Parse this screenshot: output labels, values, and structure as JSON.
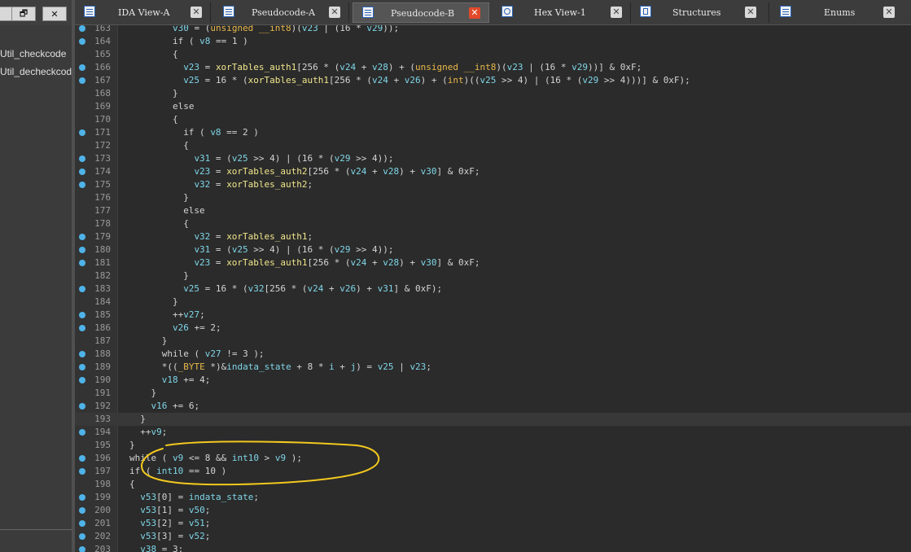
{
  "left_panel": {
    "buttons": [
      "",
      "🗗",
      "✕"
    ],
    "functions": [
      "Util_checkcode",
      "Util_decheckcode"
    ]
  },
  "tabs": [
    {
      "label": "IDA View-A",
      "icon": "listing-icon",
      "active": false
    },
    {
      "label": "Pseudocode-A",
      "icon": "pseudocode-icon",
      "active": false
    },
    {
      "label": "Pseudocode-B",
      "icon": "pseudocode-icon",
      "active": true
    },
    {
      "label": "Hex View-1",
      "icon": "hex-icon",
      "active": false
    },
    {
      "label": "Structures",
      "icon": "structures-icon",
      "active": false
    },
    {
      "label": "Enums",
      "icon": "enums-icon",
      "active": false
    }
  ],
  "tab_close_glyph": "✕",
  "highlighted_line": 193,
  "colors": {
    "breakpoint_dot": "#4fb3e8",
    "annotation_ellipse": "#f2c81e",
    "active_close": "#e2492b"
  },
  "code_lines": [
    {
      "n": 163,
      "dot": true,
      "indent": 7,
      "tokens": [
        [
          "v",
          "v30"
        ],
        [
          "p",
          " = ("
        ],
        [
          "k",
          "unsigned __int8"
        ],
        [
          "p",
          ")("
        ],
        [
          "v",
          "v23"
        ],
        [
          "p",
          " | (16 * "
        ],
        [
          "v",
          "v29"
        ],
        [
          "p",
          "));"
        ]
      ]
    },
    {
      "n": 164,
      "dot": true,
      "indent": 7,
      "tokens": [
        [
          "p",
          "if ( "
        ],
        [
          "v",
          "v8"
        ],
        [
          "p",
          " == 1 )"
        ]
      ]
    },
    {
      "n": 165,
      "dot": false,
      "indent": 7,
      "tokens": [
        [
          "p",
          "{"
        ]
      ]
    },
    {
      "n": 166,
      "dot": true,
      "indent": 8,
      "tokens": [
        [
          "v",
          "v23"
        ],
        [
          "p",
          " = "
        ],
        [
          "f",
          "xorTables_auth1"
        ],
        [
          "p",
          "[256 * ("
        ],
        [
          "v",
          "v24"
        ],
        [
          "p",
          " + "
        ],
        [
          "v",
          "v28"
        ],
        [
          "p",
          ") + ("
        ],
        [
          "k",
          "unsigned __int8"
        ],
        [
          "p",
          ")("
        ],
        [
          "v",
          "v23"
        ],
        [
          "p",
          " | (16 * "
        ],
        [
          "v",
          "v29"
        ],
        [
          "p",
          "))] & 0xF;"
        ]
      ]
    },
    {
      "n": 167,
      "dot": true,
      "indent": 8,
      "tokens": [
        [
          "v",
          "v25"
        ],
        [
          "p",
          " = 16 * ("
        ],
        [
          "f",
          "xorTables_auth1"
        ],
        [
          "p",
          "[256 * ("
        ],
        [
          "v",
          "v24"
        ],
        [
          "p",
          " + "
        ],
        [
          "v",
          "v26"
        ],
        [
          "p",
          ") + ("
        ],
        [
          "k",
          "int"
        ],
        [
          "p",
          ")(("
        ],
        [
          "v",
          "v25"
        ],
        [
          "p",
          " >> 4) | (16 * ("
        ],
        [
          "v",
          "v29"
        ],
        [
          "p",
          " >> 4)))] & 0xF);"
        ]
      ]
    },
    {
      "n": 168,
      "dot": false,
      "indent": 7,
      "tokens": [
        [
          "p",
          "}"
        ]
      ]
    },
    {
      "n": 169,
      "dot": false,
      "indent": 7,
      "tokens": [
        [
          "p",
          "else"
        ]
      ]
    },
    {
      "n": 170,
      "dot": false,
      "indent": 7,
      "tokens": [
        [
          "p",
          "{"
        ]
      ]
    },
    {
      "n": 171,
      "dot": true,
      "indent": 8,
      "tokens": [
        [
          "p",
          "if ( "
        ],
        [
          "v",
          "v8"
        ],
        [
          "p",
          " == 2 )"
        ]
      ]
    },
    {
      "n": 172,
      "dot": false,
      "indent": 8,
      "tokens": [
        [
          "p",
          "{"
        ]
      ]
    },
    {
      "n": 173,
      "dot": true,
      "indent": 9,
      "tokens": [
        [
          "v",
          "v31"
        ],
        [
          "p",
          " = ("
        ],
        [
          "v",
          "v25"
        ],
        [
          "p",
          " >> 4) | (16 * ("
        ],
        [
          "v",
          "v29"
        ],
        [
          "p",
          " >> 4));"
        ]
      ]
    },
    {
      "n": 174,
      "dot": true,
      "indent": 9,
      "tokens": [
        [
          "v",
          "v23"
        ],
        [
          "p",
          " = "
        ],
        [
          "f",
          "xorTables_auth2"
        ],
        [
          "p",
          "[256 * ("
        ],
        [
          "v",
          "v24"
        ],
        [
          "p",
          " + "
        ],
        [
          "v",
          "v28"
        ],
        [
          "p",
          ") + "
        ],
        [
          "v",
          "v30"
        ],
        [
          "p",
          "] & 0xF;"
        ]
      ]
    },
    {
      "n": 175,
      "dot": true,
      "indent": 9,
      "tokens": [
        [
          "v",
          "v32"
        ],
        [
          "p",
          " = "
        ],
        [
          "f",
          "xorTables_auth2"
        ],
        [
          "p",
          ";"
        ]
      ]
    },
    {
      "n": 176,
      "dot": false,
      "indent": 8,
      "tokens": [
        [
          "p",
          "}"
        ]
      ]
    },
    {
      "n": 177,
      "dot": false,
      "indent": 8,
      "tokens": [
        [
          "p",
          "else"
        ]
      ]
    },
    {
      "n": 178,
      "dot": false,
      "indent": 8,
      "tokens": [
        [
          "p",
          "{"
        ]
      ]
    },
    {
      "n": 179,
      "dot": true,
      "indent": 9,
      "tokens": [
        [
          "v",
          "v32"
        ],
        [
          "p",
          " = "
        ],
        [
          "f",
          "xorTables_auth1"
        ],
        [
          "p",
          ";"
        ]
      ]
    },
    {
      "n": 180,
      "dot": true,
      "indent": 9,
      "tokens": [
        [
          "v",
          "v31"
        ],
        [
          "p",
          " = ("
        ],
        [
          "v",
          "v25"
        ],
        [
          "p",
          " >> 4) | (16 * ("
        ],
        [
          "v",
          "v29"
        ],
        [
          "p",
          " >> 4));"
        ]
      ]
    },
    {
      "n": 181,
      "dot": true,
      "indent": 9,
      "tokens": [
        [
          "v",
          "v23"
        ],
        [
          "p",
          " = "
        ],
        [
          "f",
          "xorTables_auth1"
        ],
        [
          "p",
          "[256 * ("
        ],
        [
          "v",
          "v24"
        ],
        [
          "p",
          " + "
        ],
        [
          "v",
          "v28"
        ],
        [
          "p",
          ") + "
        ],
        [
          "v",
          "v30"
        ],
        [
          "p",
          "] & 0xF;"
        ]
      ]
    },
    {
      "n": 182,
      "dot": false,
      "indent": 8,
      "tokens": [
        [
          "p",
          "}"
        ]
      ]
    },
    {
      "n": 183,
      "dot": true,
      "indent": 8,
      "tokens": [
        [
          "v",
          "v25"
        ],
        [
          "p",
          " = 16 * ("
        ],
        [
          "v",
          "v32"
        ],
        [
          "p",
          "[256 * ("
        ],
        [
          "v",
          "v24"
        ],
        [
          "p",
          " + "
        ],
        [
          "v",
          "v26"
        ],
        [
          "p",
          ") + "
        ],
        [
          "v",
          "v31"
        ],
        [
          "p",
          "] & 0xF);"
        ]
      ]
    },
    {
      "n": 184,
      "dot": false,
      "indent": 7,
      "tokens": [
        [
          "p",
          "}"
        ]
      ]
    },
    {
      "n": 185,
      "dot": true,
      "indent": 7,
      "tokens": [
        [
          "p",
          "++"
        ],
        [
          "v",
          "v27"
        ],
        [
          "p",
          ";"
        ]
      ]
    },
    {
      "n": 186,
      "dot": true,
      "indent": 7,
      "tokens": [
        [
          "v",
          "v26"
        ],
        [
          "p",
          " += 2;"
        ]
      ]
    },
    {
      "n": 187,
      "dot": false,
      "indent": 6,
      "tokens": [
        [
          "p",
          "}"
        ]
      ]
    },
    {
      "n": 188,
      "dot": true,
      "indent": 6,
      "tokens": [
        [
          "p",
          "while ( "
        ],
        [
          "v",
          "v27"
        ],
        [
          "p",
          " != 3 );"
        ]
      ]
    },
    {
      "n": 189,
      "dot": true,
      "indent": 6,
      "tokens": [
        [
          "p",
          "*(("
        ],
        [
          "k",
          "_BYTE"
        ],
        [
          "p",
          " *)&"
        ],
        [
          "v",
          "indata_state"
        ],
        [
          "p",
          " + 8 * "
        ],
        [
          "v",
          "i"
        ],
        [
          "p",
          " + "
        ],
        [
          "v",
          "j"
        ],
        [
          "p",
          ") = "
        ],
        [
          "v",
          "v25"
        ],
        [
          "p",
          " | "
        ],
        [
          "v",
          "v23"
        ],
        [
          "p",
          ";"
        ]
      ]
    },
    {
      "n": 190,
      "dot": true,
      "indent": 6,
      "tokens": [
        [
          "v",
          "v18"
        ],
        [
          "p",
          " += 4;"
        ]
      ]
    },
    {
      "n": 191,
      "dot": false,
      "indent": 5,
      "tokens": [
        [
          "p",
          "}"
        ]
      ]
    },
    {
      "n": 192,
      "dot": true,
      "indent": 5,
      "tokens": [
        [
          "v",
          "v16"
        ],
        [
          "p",
          " += 6;"
        ]
      ]
    },
    {
      "n": 193,
      "dot": false,
      "indent": 4,
      "tokens": [
        [
          "p",
          "}"
        ]
      ]
    },
    {
      "n": 194,
      "dot": true,
      "indent": 4,
      "tokens": [
        [
          "p",
          "++"
        ],
        [
          "v",
          "v9"
        ],
        [
          "p",
          ";"
        ]
      ]
    },
    {
      "n": 195,
      "dot": false,
      "indent": 3,
      "tokens": [
        [
          "p",
          "}"
        ]
      ]
    },
    {
      "n": 196,
      "dot": true,
      "indent": 3,
      "tokens": [
        [
          "p",
          "while ( "
        ],
        [
          "v",
          "v9"
        ],
        [
          "p",
          " <= 8 && "
        ],
        [
          "v",
          "int10"
        ],
        [
          "p",
          " > "
        ],
        [
          "v",
          "v9"
        ],
        [
          "p",
          " );"
        ]
      ]
    },
    {
      "n": 197,
      "dot": true,
      "indent": 3,
      "tokens": [
        [
          "p",
          "if ( "
        ],
        [
          "v",
          "int10"
        ],
        [
          "p",
          " == 10 )"
        ]
      ]
    },
    {
      "n": 198,
      "dot": false,
      "indent": 3,
      "tokens": [
        [
          "p",
          "{"
        ]
      ]
    },
    {
      "n": 199,
      "dot": true,
      "indent": 4,
      "tokens": [
        [
          "v",
          "v53"
        ],
        [
          "p",
          "[0] = "
        ],
        [
          "v",
          "indata_state"
        ],
        [
          "p",
          ";"
        ]
      ]
    },
    {
      "n": 200,
      "dot": true,
      "indent": 4,
      "tokens": [
        [
          "v",
          "v53"
        ],
        [
          "p",
          "[1] = "
        ],
        [
          "v",
          "v50"
        ],
        [
          "p",
          ";"
        ]
      ]
    },
    {
      "n": 201,
      "dot": true,
      "indent": 4,
      "tokens": [
        [
          "v",
          "v53"
        ],
        [
          "p",
          "[2] = "
        ],
        [
          "v",
          "v51"
        ],
        [
          "p",
          ";"
        ]
      ]
    },
    {
      "n": 202,
      "dot": true,
      "indent": 4,
      "tokens": [
        [
          "v",
          "v53"
        ],
        [
          "p",
          "[3] = "
        ],
        [
          "v",
          "v52"
        ],
        [
          "p",
          ";"
        ]
      ]
    },
    {
      "n": 203,
      "dot": true,
      "indent": 4,
      "tokens": [
        [
          "v",
          "v38"
        ],
        [
          "p",
          " = 3;"
        ]
      ]
    }
  ]
}
